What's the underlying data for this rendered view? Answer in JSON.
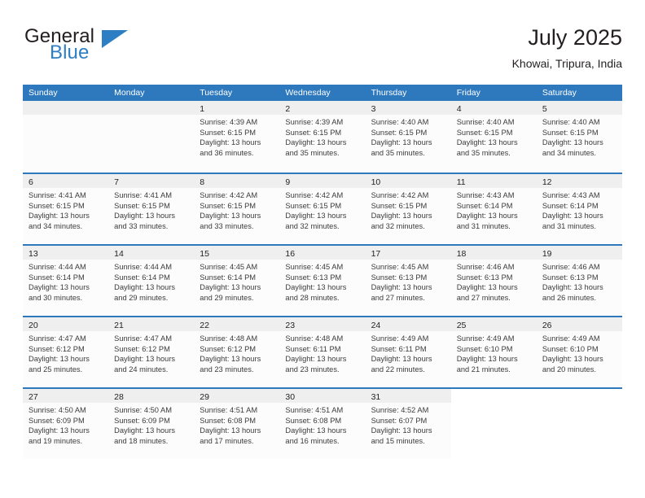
{
  "brand": {
    "name_top": "General",
    "name_bottom": "Blue",
    "triangle_color": "#2e7ec4",
    "top_color": "#231f20"
  },
  "header": {
    "title": "July 2025",
    "subtitle": "Khowai, Tripura, India"
  },
  "colors": {
    "header_blue": "#2e78bd",
    "day_band_gray": "#efefef",
    "cell_white": "#fcfcfc",
    "text": "#231f20"
  },
  "weekdays": [
    "Sunday",
    "Monday",
    "Tuesday",
    "Wednesday",
    "Thursday",
    "Friday",
    "Saturday"
  ],
  "weeks": [
    [
      {
        "day": "",
        "empty": true
      },
      {
        "day": "",
        "empty": true
      },
      {
        "day": "1",
        "sunrise": "Sunrise: 4:39 AM",
        "sunset": "Sunset: 6:15 PM",
        "daylight_1": "Daylight: 13 hours",
        "daylight_2": "and 36 minutes."
      },
      {
        "day": "2",
        "sunrise": "Sunrise: 4:39 AM",
        "sunset": "Sunset: 6:15 PM",
        "daylight_1": "Daylight: 13 hours",
        "daylight_2": "and 35 minutes."
      },
      {
        "day": "3",
        "sunrise": "Sunrise: 4:40 AM",
        "sunset": "Sunset: 6:15 PM",
        "daylight_1": "Daylight: 13 hours",
        "daylight_2": "and 35 minutes."
      },
      {
        "day": "4",
        "sunrise": "Sunrise: 4:40 AM",
        "sunset": "Sunset: 6:15 PM",
        "daylight_1": "Daylight: 13 hours",
        "daylight_2": "and 35 minutes."
      },
      {
        "day": "5",
        "sunrise": "Sunrise: 4:40 AM",
        "sunset": "Sunset: 6:15 PM",
        "daylight_1": "Daylight: 13 hours",
        "daylight_2": "and 34 minutes."
      }
    ],
    [
      {
        "day": "6",
        "sunrise": "Sunrise: 4:41 AM",
        "sunset": "Sunset: 6:15 PM",
        "daylight_1": "Daylight: 13 hours",
        "daylight_2": "and 34 minutes."
      },
      {
        "day": "7",
        "sunrise": "Sunrise: 4:41 AM",
        "sunset": "Sunset: 6:15 PM",
        "daylight_1": "Daylight: 13 hours",
        "daylight_2": "and 33 minutes."
      },
      {
        "day": "8",
        "sunrise": "Sunrise: 4:42 AM",
        "sunset": "Sunset: 6:15 PM",
        "daylight_1": "Daylight: 13 hours",
        "daylight_2": "and 33 minutes."
      },
      {
        "day": "9",
        "sunrise": "Sunrise: 4:42 AM",
        "sunset": "Sunset: 6:15 PM",
        "daylight_1": "Daylight: 13 hours",
        "daylight_2": "and 32 minutes."
      },
      {
        "day": "10",
        "sunrise": "Sunrise: 4:42 AM",
        "sunset": "Sunset: 6:15 PM",
        "daylight_1": "Daylight: 13 hours",
        "daylight_2": "and 32 minutes."
      },
      {
        "day": "11",
        "sunrise": "Sunrise: 4:43 AM",
        "sunset": "Sunset: 6:14 PM",
        "daylight_1": "Daylight: 13 hours",
        "daylight_2": "and 31 minutes."
      },
      {
        "day": "12",
        "sunrise": "Sunrise: 4:43 AM",
        "sunset": "Sunset: 6:14 PM",
        "daylight_1": "Daylight: 13 hours",
        "daylight_2": "and 31 minutes."
      }
    ],
    [
      {
        "day": "13",
        "sunrise": "Sunrise: 4:44 AM",
        "sunset": "Sunset: 6:14 PM",
        "daylight_1": "Daylight: 13 hours",
        "daylight_2": "and 30 minutes."
      },
      {
        "day": "14",
        "sunrise": "Sunrise: 4:44 AM",
        "sunset": "Sunset: 6:14 PM",
        "daylight_1": "Daylight: 13 hours",
        "daylight_2": "and 29 minutes."
      },
      {
        "day": "15",
        "sunrise": "Sunrise: 4:45 AM",
        "sunset": "Sunset: 6:14 PM",
        "daylight_1": "Daylight: 13 hours",
        "daylight_2": "and 29 minutes."
      },
      {
        "day": "16",
        "sunrise": "Sunrise: 4:45 AM",
        "sunset": "Sunset: 6:13 PM",
        "daylight_1": "Daylight: 13 hours",
        "daylight_2": "and 28 minutes."
      },
      {
        "day": "17",
        "sunrise": "Sunrise: 4:45 AM",
        "sunset": "Sunset: 6:13 PM",
        "daylight_1": "Daylight: 13 hours",
        "daylight_2": "and 27 minutes."
      },
      {
        "day": "18",
        "sunrise": "Sunrise: 4:46 AM",
        "sunset": "Sunset: 6:13 PM",
        "daylight_1": "Daylight: 13 hours",
        "daylight_2": "and 27 minutes."
      },
      {
        "day": "19",
        "sunrise": "Sunrise: 4:46 AM",
        "sunset": "Sunset: 6:13 PM",
        "daylight_1": "Daylight: 13 hours",
        "daylight_2": "and 26 minutes."
      }
    ],
    [
      {
        "day": "20",
        "sunrise": "Sunrise: 4:47 AM",
        "sunset": "Sunset: 6:12 PM",
        "daylight_1": "Daylight: 13 hours",
        "daylight_2": "and 25 minutes."
      },
      {
        "day": "21",
        "sunrise": "Sunrise: 4:47 AM",
        "sunset": "Sunset: 6:12 PM",
        "daylight_1": "Daylight: 13 hours",
        "daylight_2": "and 24 minutes."
      },
      {
        "day": "22",
        "sunrise": "Sunrise: 4:48 AM",
        "sunset": "Sunset: 6:12 PM",
        "daylight_1": "Daylight: 13 hours",
        "daylight_2": "and 23 minutes."
      },
      {
        "day": "23",
        "sunrise": "Sunrise: 4:48 AM",
        "sunset": "Sunset: 6:11 PM",
        "daylight_1": "Daylight: 13 hours",
        "daylight_2": "and 23 minutes."
      },
      {
        "day": "24",
        "sunrise": "Sunrise: 4:49 AM",
        "sunset": "Sunset: 6:11 PM",
        "daylight_1": "Daylight: 13 hours",
        "daylight_2": "and 22 minutes."
      },
      {
        "day": "25",
        "sunrise": "Sunrise: 4:49 AM",
        "sunset": "Sunset: 6:10 PM",
        "daylight_1": "Daylight: 13 hours",
        "daylight_2": "and 21 minutes."
      },
      {
        "day": "26",
        "sunrise": "Sunrise: 4:49 AM",
        "sunset": "Sunset: 6:10 PM",
        "daylight_1": "Daylight: 13 hours",
        "daylight_2": "and 20 minutes."
      }
    ],
    [
      {
        "day": "27",
        "sunrise": "Sunrise: 4:50 AM",
        "sunset": "Sunset: 6:09 PM",
        "daylight_1": "Daylight: 13 hours",
        "daylight_2": "and 19 minutes."
      },
      {
        "day": "28",
        "sunrise": "Sunrise: 4:50 AM",
        "sunset": "Sunset: 6:09 PM",
        "daylight_1": "Daylight: 13 hours",
        "daylight_2": "and 18 minutes."
      },
      {
        "day": "29",
        "sunrise": "Sunrise: 4:51 AM",
        "sunset": "Sunset: 6:08 PM",
        "daylight_1": "Daylight: 13 hours",
        "daylight_2": "and 17 minutes."
      },
      {
        "day": "30",
        "sunrise": "Sunrise: 4:51 AM",
        "sunset": "Sunset: 6:08 PM",
        "daylight_1": "Daylight: 13 hours",
        "daylight_2": "and 16 minutes."
      },
      {
        "day": "31",
        "sunrise": "Sunrise: 4:52 AM",
        "sunset": "Sunset: 6:07 PM",
        "daylight_1": "Daylight: 13 hours",
        "daylight_2": "and 15 minutes."
      },
      {
        "day": "",
        "empty": true,
        "blank": true
      },
      {
        "day": "",
        "empty": true,
        "blank": true
      }
    ]
  ]
}
